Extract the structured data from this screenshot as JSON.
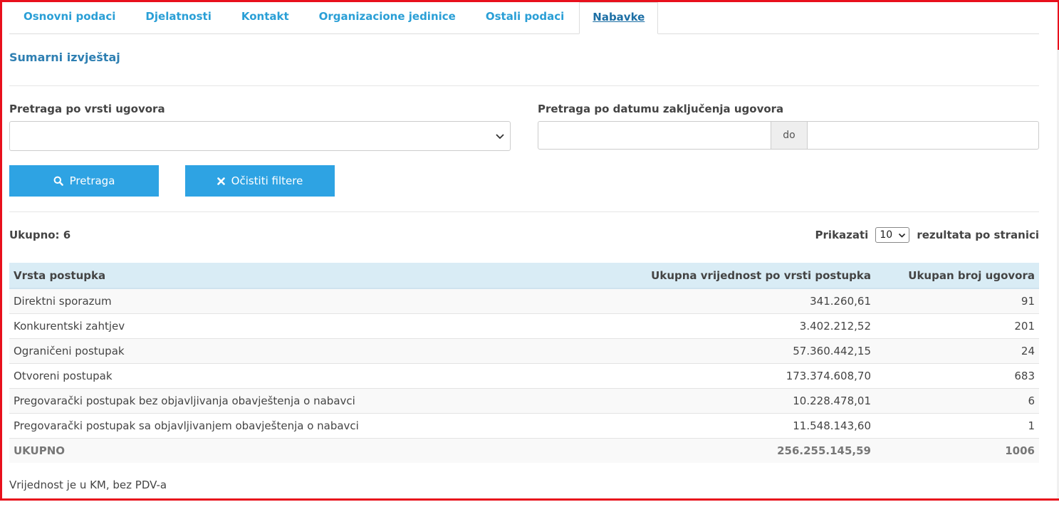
{
  "tabs": [
    {
      "label": "Osnovni podaci",
      "active": false
    },
    {
      "label": "Djelatnosti",
      "active": false
    },
    {
      "label": "Kontakt",
      "active": false
    },
    {
      "label": "Organizacione jedinice",
      "active": false
    },
    {
      "label": "Ostali podaci",
      "active": false
    },
    {
      "label": "Nabavke",
      "active": true
    }
  ],
  "section_title": "Sumarni izvještaj",
  "filters": {
    "contract_type_label": "Pretraga po vrsti ugovora",
    "contract_type_value": "",
    "date_label": "Pretraga po datumu zaključenja ugovora",
    "date_from": "",
    "date_separator": "do",
    "date_to": ""
  },
  "buttons": {
    "search_label": "Pretraga",
    "clear_label": "Očistiti filtere"
  },
  "summary": {
    "total_label": "Ukupno: 6",
    "show_label": "Prikazati",
    "page_size": "10",
    "per_page_label": "rezultata po stranici"
  },
  "table": {
    "headers": [
      "Vrsta postupka",
      "Ukupna vrijednost po vrsti postupka",
      "Ukupan broj ugovora"
    ],
    "rows": [
      {
        "type": "Direktni sporazum",
        "value": "341.260,61",
        "count": "91"
      },
      {
        "type": "Konkurentski zahtjev",
        "value": "3.402.212,52",
        "count": "201"
      },
      {
        "type": "Ograničeni postupak",
        "value": "57.360.442,15",
        "count": "24"
      },
      {
        "type": "Otvoreni postupak",
        "value": "173.374.608,70",
        "count": "683"
      },
      {
        "type": "Pregovarački postupak bez objavljivanja obavještenja o nabavci",
        "value": "10.228.478,01",
        "count": "6"
      },
      {
        "type": "Pregovarački postupak sa objavljivanjem obavještenja o nabavci",
        "value": "11.548.143,60",
        "count": "1"
      }
    ],
    "total": {
      "type": "UKUPNO",
      "value": "256.255.145,59",
      "count": "1006"
    }
  },
  "footnote": "Vrijednost je u KM, bez PDV-a",
  "colors": {
    "accent": "#2ea3e3",
    "tab_text": "#2a9fd6",
    "header_bg": "#d9ecf5",
    "frame_border": "#e8101c"
  },
  "icons": {
    "search_button": "search-icon",
    "clear_button": "close-icon",
    "dropdown": "chevron-down-icon"
  }
}
